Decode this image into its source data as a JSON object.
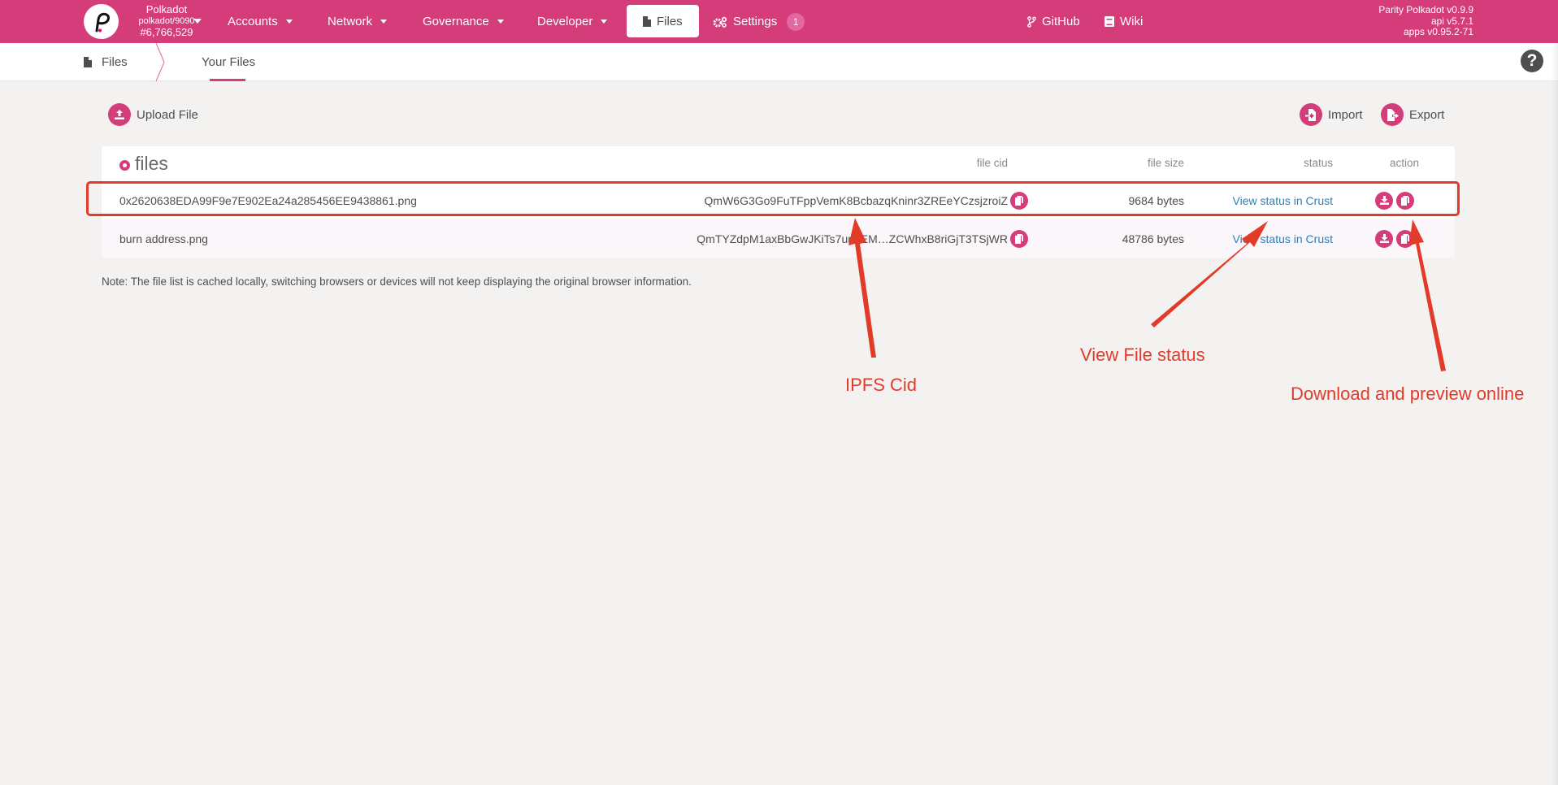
{
  "topbar": {
    "chain_name": "Polkadot",
    "node": "polkadot/9090",
    "block": "#6,766,529",
    "nav": [
      {
        "label": "Accounts",
        "dropdown": true
      },
      {
        "label": "Network",
        "dropdown": true
      },
      {
        "label": "Governance",
        "dropdown": true
      },
      {
        "label": "Developer",
        "dropdown": true
      },
      {
        "label": "Files",
        "active": true,
        "icon": "file-icon"
      },
      {
        "label": "Settings",
        "icon": "gears-icon",
        "badge": "1"
      }
    ],
    "links": [
      {
        "label": "GitHub",
        "icon": "code-branch-icon"
      },
      {
        "label": "Wiki",
        "icon": "book-icon"
      }
    ],
    "versions": [
      "Parity Polkadot v0.9.9",
      "api v5.7.1",
      "apps v0.95.2-71"
    ]
  },
  "subbar": {
    "root_label": "Files",
    "tab_label": "Your Files",
    "help_icon": "?"
  },
  "actions": {
    "upload": "Upload File",
    "import": "Import",
    "export": "Export"
  },
  "table": {
    "title": "files",
    "headers": {
      "cid": "file cid",
      "size": "file size",
      "status": "status",
      "action": "action"
    },
    "rows": [
      {
        "name": "0x2620638EDA99F9e7E902Ea24a285456EE9438861.png",
        "cid": "QmW6G3Go9FuTFppVemK8BcbazqKninr3ZREeYCzsjzroiZ",
        "size": "9684 bytes",
        "status": "View status in Crust"
      },
      {
        "name": "burn address.png",
        "cid": "QmTYZdpM1axBbGwJKiTs7urGEM…ZCWhxB8riGjT3TSjWR",
        "size": "48786 bytes",
        "status": "View status in Crust"
      }
    ]
  },
  "note": "Note: The file list is cached locally, switching browsers or devices will not keep displaying the original browser information.",
  "annotations": {
    "cid": "IPFS Cid",
    "status": "View File status",
    "actions": "Download and preview online",
    "color": "#e23b2a"
  },
  "colors": {
    "brand": "#d43c7a",
    "link": "#2f7fb5",
    "background": "#f3f2f1"
  }
}
